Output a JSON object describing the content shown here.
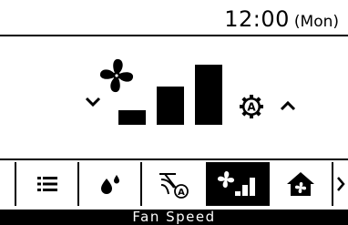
{
  "header": {
    "time": "12:00",
    "day": "(Mon)"
  },
  "fan_speed": {
    "level": 3,
    "max_level": 3,
    "auto_badge": "A",
    "decrease_icon": "chevron-down-icon",
    "increase_icon": "chevron-up-icon"
  },
  "menu": {
    "items": [
      {
        "icon": "menu-list-icon",
        "selected": false
      },
      {
        "icon": "dry-droplets-icon",
        "selected": false
      },
      {
        "icon": "airflow-auto-icon",
        "selected": false
      },
      {
        "icon": "fan-speed-icon",
        "selected": true
      },
      {
        "icon": "home-fan-icon",
        "selected": false
      },
      {
        "icon": "chevron-right-icon",
        "selected": false
      }
    ]
  },
  "status": {
    "label": "Fan Speed"
  },
  "colors": {
    "foreground": "#000000",
    "background": "#ffffff"
  }
}
